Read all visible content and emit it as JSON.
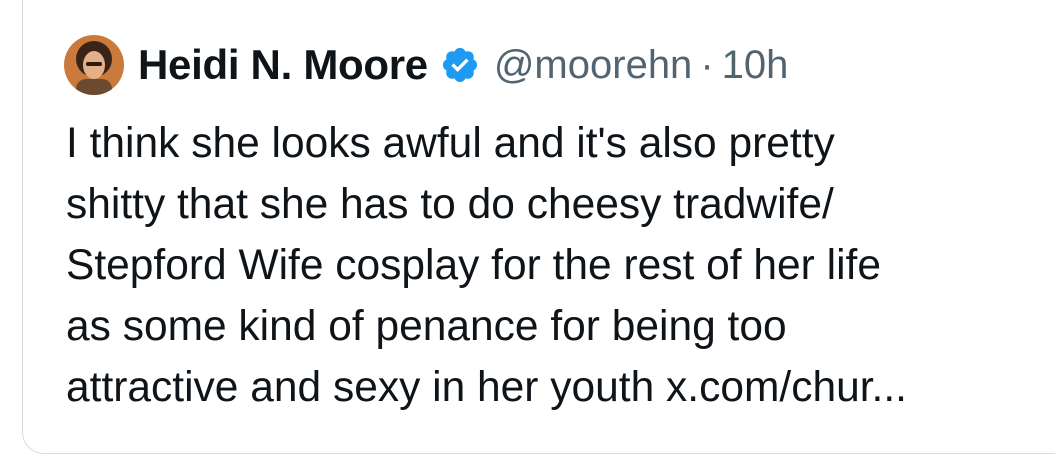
{
  "author": {
    "display_name": "Heidi N. Moore",
    "handle": "@moorehn",
    "separator": "·",
    "timestamp": "10h",
    "verified": true,
    "verified_color": "#1d9bf0",
    "avatar_icon": "profile-photo"
  },
  "tweet": {
    "lines": [
      "I think she looks awful and it's also pretty",
      "shitty that she has to do cheesy tradwife/",
      "Stepford Wife cosplay for the rest of her life",
      "as some kind of penance for being too",
      "attractive and sexy in her youth x.com/chur..."
    ]
  },
  "colors": {
    "text": "#0f1419",
    "secondary": "#536471",
    "border": "#d6dce1"
  }
}
